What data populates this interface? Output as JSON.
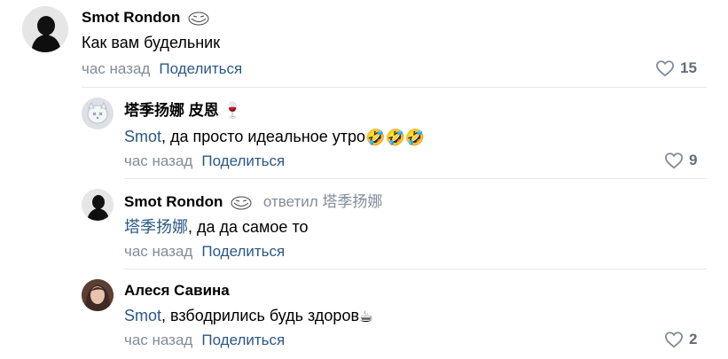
{
  "comments": [
    {
      "author": "Smot Rondon",
      "text": "Как вам будельник",
      "time": "час назад",
      "share": "Поделиться",
      "likes": "15"
    },
    {
      "author": "塔季扬娜 皮恩",
      "author_emoji": "🍷",
      "mention": "Smot",
      "text": ", да просто идеальное утро",
      "emoji": "🤣🤣🤣",
      "time": "час назад",
      "share": "Поделиться",
      "likes": "9"
    },
    {
      "author": "Smot Rondon",
      "replied": "ответил 塔季扬娜",
      "mention": "塔季扬娜",
      "text": ", да да самое то",
      "time": "час назад",
      "share": "Поделиться"
    },
    {
      "author": "Алеся Савина",
      "mention": "Smot",
      "text": ", взбодрились будь здоров",
      "emoji": "☕",
      "time": "час назад",
      "share": "Поделиться",
      "likes": "2"
    }
  ],
  "icons": {
    "like": "heart-outline-icon",
    "badge": "trollface-icon"
  },
  "colors": {
    "link": "#2a5885",
    "meta": "#818c99",
    "divider": "#e7e8ec"
  }
}
